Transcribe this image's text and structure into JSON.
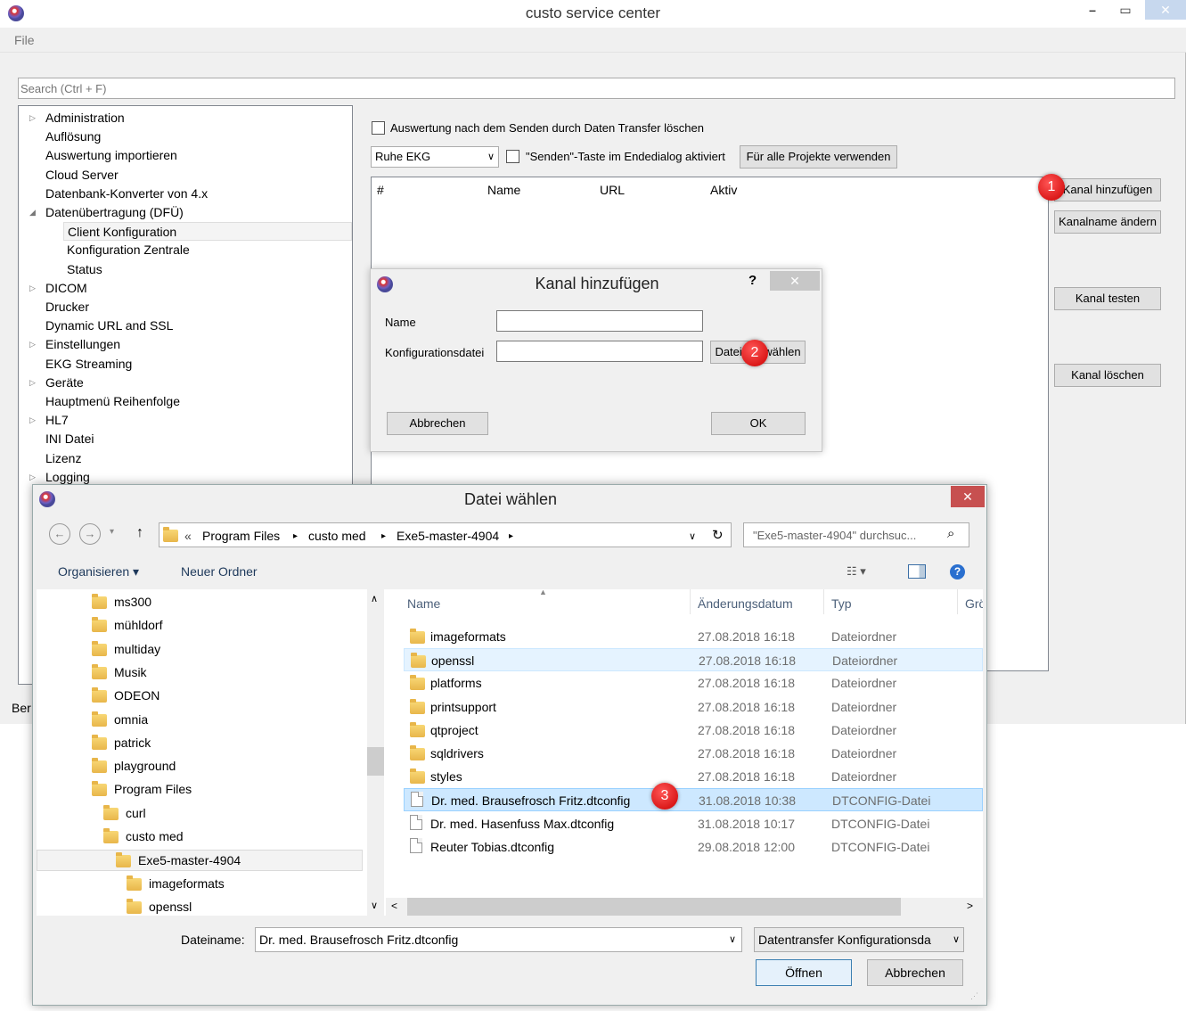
{
  "window": {
    "title": "custo service center"
  },
  "menu": {
    "file": "File"
  },
  "search": {
    "placeholder": "Search (Ctrl + F)"
  },
  "tree": [
    {
      "label": "Administration",
      "expander": "▷"
    },
    {
      "label": "Auflösung"
    },
    {
      "label": "Auswertung importieren"
    },
    {
      "label": "Cloud Server"
    },
    {
      "label": "Datenbank-Konverter von 4.x"
    },
    {
      "label": "Datenübertragung (DFÜ)",
      "expander": "◢"
    },
    {
      "label": "Client Konfiguration",
      "selected": true
    },
    {
      "label": "Konfiguration Zentrale"
    },
    {
      "label": "Status"
    },
    {
      "label": "DICOM",
      "expander": "▷"
    },
    {
      "label": "Drucker"
    },
    {
      "label": "Dynamic URL and SSL"
    },
    {
      "label": "Einstellungen",
      "expander": "▷"
    },
    {
      "label": "EKG Streaming"
    },
    {
      "label": "Geräte",
      "expander": "▷"
    },
    {
      "label": "Hauptmenü Reihenfolge"
    },
    {
      "label": "HL7",
      "expander": "▷"
    },
    {
      "label": "INI Datei"
    },
    {
      "label": "Lizenz"
    },
    {
      "label": "Logging",
      "expander": "▷"
    }
  ],
  "config": {
    "delete_after_send_label": "Auswertung nach dem Senden durch Daten Transfer löschen",
    "project_select": "Ruhe EKG",
    "send_button_label": "\"Senden\"-Taste im Endedialog aktiviert",
    "apply_all_button": "Für alle Projekte verwenden",
    "columns": [
      "#",
      "Name",
      "URL",
      "Aktiv"
    ],
    "buttons": {
      "add": "Kanal hinzufügen",
      "rename": "Kanalname ändern",
      "test": "Kanal testen",
      "delete": "Kanal löschen"
    }
  },
  "statusbar": {
    "text": "Ber"
  },
  "add_dialog": {
    "title": "Kanal hinzufügen",
    "help": "?",
    "name_label": "Name",
    "name_value": "",
    "config_label": "Konfigurationsdatei",
    "config_value": "",
    "choose_file_button": "Datei auswählen",
    "cancel_button": "Abbrechen",
    "ok_button": "OK"
  },
  "badges": [
    "1",
    "2",
    "3"
  ],
  "file_dialog": {
    "title": "Datei wählen",
    "breadcrumb": [
      "«",
      "Program Files",
      "custo med",
      "Exe5-master-4904"
    ],
    "search_placeholder": "\"Exe5-master-4904\" durchsuc...",
    "organize": "Organisieren ▾",
    "new_folder": "Neuer Ordner",
    "nav_items": [
      {
        "label": "ms300",
        "level": 0
      },
      {
        "label": "mühldorf",
        "level": 0
      },
      {
        "label": "multiday",
        "level": 0
      },
      {
        "label": "Musik",
        "level": 0
      },
      {
        "label": "ODEON",
        "level": 0
      },
      {
        "label": "omnia",
        "level": 0
      },
      {
        "label": "patrick",
        "level": 0
      },
      {
        "label": "playground",
        "level": 0
      },
      {
        "label": "Program Files",
        "level": 0
      },
      {
        "label": "curl",
        "level": 1
      },
      {
        "label": "custo med",
        "level": 1
      },
      {
        "label": "Exe5-master-4904",
        "level": 2,
        "selected": true
      },
      {
        "label": "imageformats",
        "level": 3
      },
      {
        "label": "openssl",
        "level": 3
      }
    ],
    "columns": {
      "name": "Name",
      "date": "Änderungsdatum",
      "type": "Typ",
      "size": "Grö"
    },
    "files": [
      {
        "name": "imageformats",
        "date": "27.08.2018 16:18",
        "type": "Dateiordner",
        "kind": "folder"
      },
      {
        "name": "openssl",
        "date": "27.08.2018 16:18",
        "type": "Dateiordner",
        "kind": "folder",
        "state": "hover"
      },
      {
        "name": "platforms",
        "date": "27.08.2018 16:18",
        "type": "Dateiordner",
        "kind": "folder"
      },
      {
        "name": "printsupport",
        "date": "27.08.2018 16:18",
        "type": "Dateiordner",
        "kind": "folder"
      },
      {
        "name": "qtproject",
        "date": "27.08.2018 16:18",
        "type": "Dateiordner",
        "kind": "folder"
      },
      {
        "name": "sqldrivers",
        "date": "27.08.2018 16:18",
        "type": "Dateiordner",
        "kind": "folder"
      },
      {
        "name": "styles",
        "date": "27.08.2018 16:18",
        "type": "Dateiordner",
        "kind": "folder"
      },
      {
        "name": "Dr. med. Brausefrosch Fritz.dtconfig",
        "date": "31.08.2018 10:38",
        "type": "DTCONFIG-Datei",
        "kind": "file",
        "state": "selected"
      },
      {
        "name": "Dr. med. Hasenfuss Max.dtconfig",
        "date": "31.08.2018 10:17",
        "type": "DTCONFIG-Datei",
        "kind": "file"
      },
      {
        "name": "Reuter Tobias.dtconfig",
        "date": "29.08.2018 12:00",
        "type": "DTCONFIG-Datei",
        "kind": "file"
      }
    ],
    "filename_label": "Dateiname:",
    "filename_value": "Dr. med. Brausefrosch Fritz.dtconfig",
    "filter": "Datentransfer Konfigurationsda",
    "open_button": "Öffnen",
    "cancel_button": "Abbrechen"
  }
}
